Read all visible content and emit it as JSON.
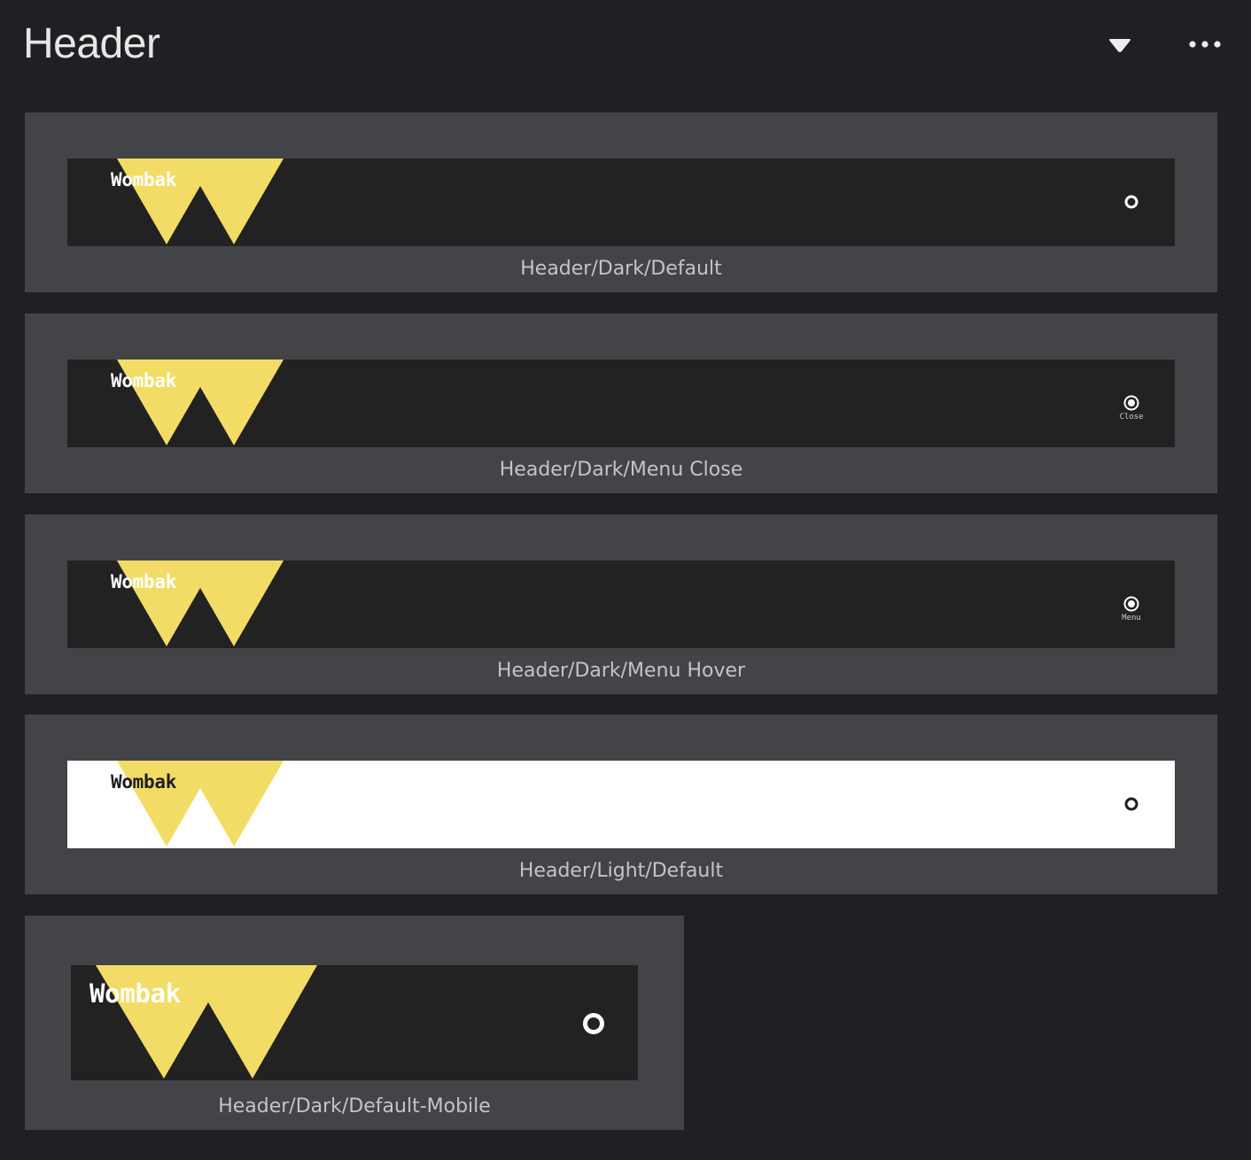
{
  "page": {
    "title": "Header"
  },
  "toolbar": {
    "dropdown_icon": "dropdown-triangle-icon",
    "more_icon": "more-horizontal-icon"
  },
  "colors": {
    "background": "#1f2023",
    "card": "#434448",
    "header_dark": "#222222",
    "header_light": "#ffffff",
    "logo_yellow": "#f2dc66"
  },
  "variants": [
    {
      "name": "Header/Dark/Default",
      "brand": "Wombak",
      "theme": "dark",
      "menu_label": ""
    },
    {
      "name": "Header/Dark/Menu Close",
      "brand": "Wombak",
      "theme": "dark",
      "menu_label": "Close"
    },
    {
      "name": "Header/Dark/Menu Hover",
      "brand": "Wombak",
      "theme": "dark",
      "menu_label": "Menu"
    },
    {
      "name": "Header/Light/Default",
      "brand": "Wombak",
      "theme": "light",
      "menu_label": ""
    },
    {
      "name": "Header/Dark/Default-Mobile",
      "brand": "Wombak",
      "theme": "dark",
      "menu_label": ""
    }
  ]
}
